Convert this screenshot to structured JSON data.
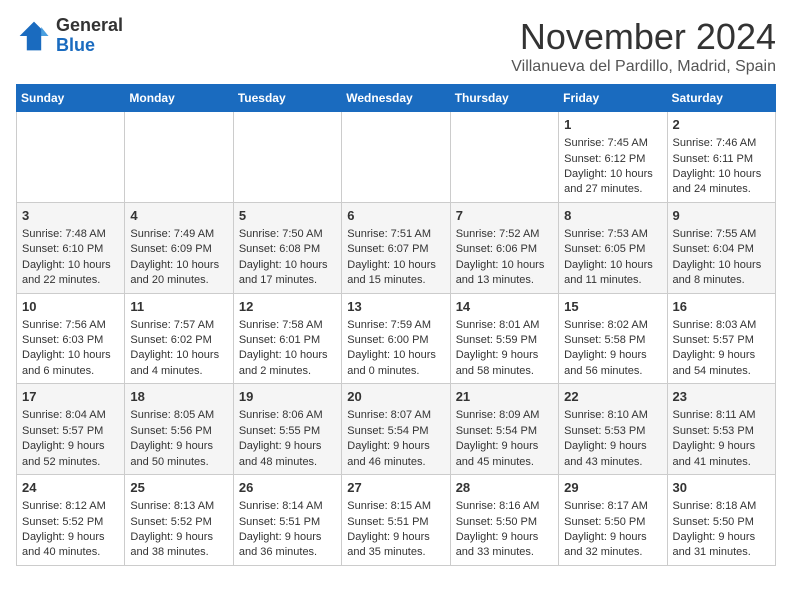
{
  "header": {
    "logo_line1": "General",
    "logo_line2": "Blue",
    "month_title": "November 2024",
    "location": "Villanueva del Pardillo, Madrid, Spain"
  },
  "days_of_week": [
    "Sunday",
    "Monday",
    "Tuesday",
    "Wednesday",
    "Thursday",
    "Friday",
    "Saturday"
  ],
  "weeks": [
    [
      {
        "day": "",
        "info": ""
      },
      {
        "day": "",
        "info": ""
      },
      {
        "day": "",
        "info": ""
      },
      {
        "day": "",
        "info": ""
      },
      {
        "day": "",
        "info": ""
      },
      {
        "day": "1",
        "info": "Sunrise: 7:45 AM\nSunset: 6:12 PM\nDaylight: 10 hours and 27 minutes."
      },
      {
        "day": "2",
        "info": "Sunrise: 7:46 AM\nSunset: 6:11 PM\nDaylight: 10 hours and 24 minutes."
      }
    ],
    [
      {
        "day": "3",
        "info": "Sunrise: 7:48 AM\nSunset: 6:10 PM\nDaylight: 10 hours and 22 minutes."
      },
      {
        "day": "4",
        "info": "Sunrise: 7:49 AM\nSunset: 6:09 PM\nDaylight: 10 hours and 20 minutes."
      },
      {
        "day": "5",
        "info": "Sunrise: 7:50 AM\nSunset: 6:08 PM\nDaylight: 10 hours and 17 minutes."
      },
      {
        "day": "6",
        "info": "Sunrise: 7:51 AM\nSunset: 6:07 PM\nDaylight: 10 hours and 15 minutes."
      },
      {
        "day": "7",
        "info": "Sunrise: 7:52 AM\nSunset: 6:06 PM\nDaylight: 10 hours and 13 minutes."
      },
      {
        "day": "8",
        "info": "Sunrise: 7:53 AM\nSunset: 6:05 PM\nDaylight: 10 hours and 11 minutes."
      },
      {
        "day": "9",
        "info": "Sunrise: 7:55 AM\nSunset: 6:04 PM\nDaylight: 10 hours and 8 minutes."
      }
    ],
    [
      {
        "day": "10",
        "info": "Sunrise: 7:56 AM\nSunset: 6:03 PM\nDaylight: 10 hours and 6 minutes."
      },
      {
        "day": "11",
        "info": "Sunrise: 7:57 AM\nSunset: 6:02 PM\nDaylight: 10 hours and 4 minutes."
      },
      {
        "day": "12",
        "info": "Sunrise: 7:58 AM\nSunset: 6:01 PM\nDaylight: 10 hours and 2 minutes."
      },
      {
        "day": "13",
        "info": "Sunrise: 7:59 AM\nSunset: 6:00 PM\nDaylight: 10 hours and 0 minutes."
      },
      {
        "day": "14",
        "info": "Sunrise: 8:01 AM\nSunset: 5:59 PM\nDaylight: 9 hours and 58 minutes."
      },
      {
        "day": "15",
        "info": "Sunrise: 8:02 AM\nSunset: 5:58 PM\nDaylight: 9 hours and 56 minutes."
      },
      {
        "day": "16",
        "info": "Sunrise: 8:03 AM\nSunset: 5:57 PM\nDaylight: 9 hours and 54 minutes."
      }
    ],
    [
      {
        "day": "17",
        "info": "Sunrise: 8:04 AM\nSunset: 5:57 PM\nDaylight: 9 hours and 52 minutes."
      },
      {
        "day": "18",
        "info": "Sunrise: 8:05 AM\nSunset: 5:56 PM\nDaylight: 9 hours and 50 minutes."
      },
      {
        "day": "19",
        "info": "Sunrise: 8:06 AM\nSunset: 5:55 PM\nDaylight: 9 hours and 48 minutes."
      },
      {
        "day": "20",
        "info": "Sunrise: 8:07 AM\nSunset: 5:54 PM\nDaylight: 9 hours and 46 minutes."
      },
      {
        "day": "21",
        "info": "Sunrise: 8:09 AM\nSunset: 5:54 PM\nDaylight: 9 hours and 45 minutes."
      },
      {
        "day": "22",
        "info": "Sunrise: 8:10 AM\nSunset: 5:53 PM\nDaylight: 9 hours and 43 minutes."
      },
      {
        "day": "23",
        "info": "Sunrise: 8:11 AM\nSunset: 5:53 PM\nDaylight: 9 hours and 41 minutes."
      }
    ],
    [
      {
        "day": "24",
        "info": "Sunrise: 8:12 AM\nSunset: 5:52 PM\nDaylight: 9 hours and 40 minutes."
      },
      {
        "day": "25",
        "info": "Sunrise: 8:13 AM\nSunset: 5:52 PM\nDaylight: 9 hours and 38 minutes."
      },
      {
        "day": "26",
        "info": "Sunrise: 8:14 AM\nSunset: 5:51 PM\nDaylight: 9 hours and 36 minutes."
      },
      {
        "day": "27",
        "info": "Sunrise: 8:15 AM\nSunset: 5:51 PM\nDaylight: 9 hours and 35 minutes."
      },
      {
        "day": "28",
        "info": "Sunrise: 8:16 AM\nSunset: 5:50 PM\nDaylight: 9 hours and 33 minutes."
      },
      {
        "day": "29",
        "info": "Sunrise: 8:17 AM\nSunset: 5:50 PM\nDaylight: 9 hours and 32 minutes."
      },
      {
        "day": "30",
        "info": "Sunrise: 8:18 AM\nSunset: 5:50 PM\nDaylight: 9 hours and 31 minutes."
      }
    ]
  ]
}
